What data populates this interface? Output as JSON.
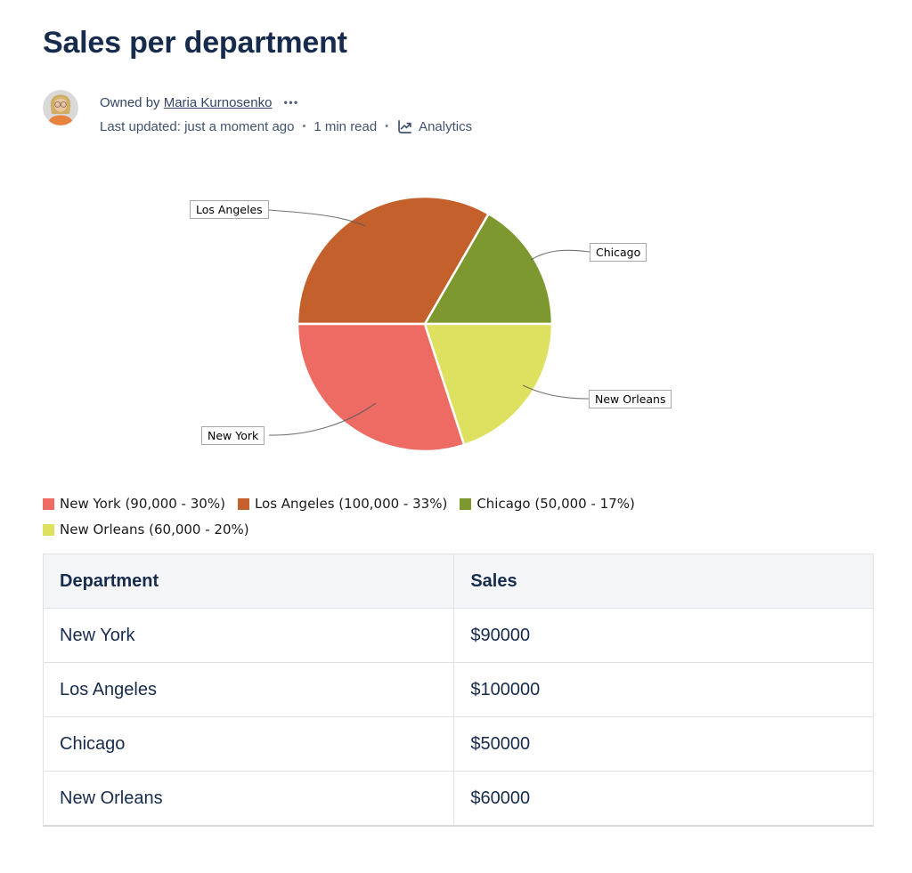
{
  "page": {
    "title": "Sales per department"
  },
  "byline": {
    "owned_by_prefix": "Owned by",
    "owner": "Maria Kurnosenko",
    "more_label": "•••",
    "last_updated": "Last updated: just a moment ago",
    "read_time": "1 min read",
    "analytics_label": "Analytics",
    "dot": "•"
  },
  "chart_data": {
    "type": "pie",
    "title": "",
    "legend_position": "bottom-left",
    "start_angle_deg": 0,
    "direction": "counterclockwise",
    "draw_order": [
      2,
      1,
      0,
      3
    ],
    "slices": [
      {
        "label": "New York",
        "value": 90000,
        "percent": 30,
        "color": "#ED6B63",
        "legend_label": "New York (90,000 - 30%)"
      },
      {
        "label": "Los Angeles",
        "value": 100000,
        "percent": 33,
        "color": "#C4602B",
        "legend_label": "Los Angeles (100,000 - 33%)"
      },
      {
        "label": "Chicago",
        "value": 50000,
        "percent": 17,
        "color": "#7D982F",
        "legend_label": "Chicago (50,000 - 17%)"
      },
      {
        "label": "New Orleans",
        "value": 60000,
        "percent": 20,
        "color": "#DDE15F",
        "legend_label": "New Orleans (60,000 - 20%)"
      }
    ]
  },
  "table": {
    "headers": [
      "Department",
      "Sales"
    ],
    "rows": [
      {
        "department": "New York",
        "sales": "$90000"
      },
      {
        "department": "Los Angeles",
        "sales": "$100000"
      },
      {
        "department": "Chicago",
        "sales": "$50000"
      },
      {
        "department": "New Orleans",
        "sales": "$60000"
      }
    ]
  }
}
